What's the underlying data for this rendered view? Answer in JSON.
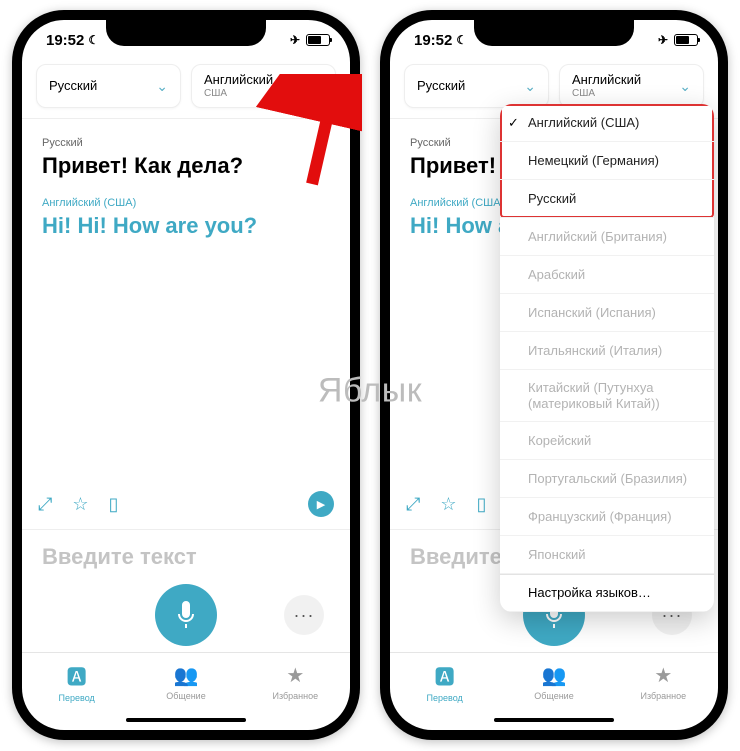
{
  "status": {
    "time": "19:52"
  },
  "lang_from": {
    "label": "Русский"
  },
  "lang_to": {
    "label": "Английский",
    "sub": "США"
  },
  "translation": {
    "src_lang": "Русский",
    "src_text": "Привет! Как дела?",
    "tgt_lang": "Английский (США)",
    "tgt_text": "Hi! Hi! How are you?",
    "tgt_text_clipped": "Hi! How a"
  },
  "input": {
    "placeholder": "Введите текст"
  },
  "tabs": {
    "translate": "Перевод",
    "conversation": "Общение",
    "favorites": "Избранное"
  },
  "dropdown": {
    "items": [
      {
        "label": "Английский (США)",
        "checked": true,
        "dim": false
      },
      {
        "label": "Немецкий (Германия)",
        "checked": false,
        "dim": false
      },
      {
        "label": "Русский",
        "checked": false,
        "dim": false
      },
      {
        "label": "Английский (Британия)",
        "checked": false,
        "dim": true
      },
      {
        "label": "Арабский",
        "checked": false,
        "dim": true
      },
      {
        "label": "Испанский (Испания)",
        "checked": false,
        "dim": true
      },
      {
        "label": "Итальянский (Италия)",
        "checked": false,
        "dim": true
      },
      {
        "label": "Китайский (Путунхуа (материковый Китай))",
        "checked": false,
        "dim": true
      },
      {
        "label": "Корейский",
        "checked": false,
        "dim": true
      },
      {
        "label": "Португальский (Бразилия)",
        "checked": false,
        "dim": true
      },
      {
        "label": "Французский (Франция)",
        "checked": false,
        "dim": true
      },
      {
        "label": "Японский",
        "checked": false,
        "dim": true
      }
    ],
    "settings": "Настройка языков…"
  },
  "watermark": "Яблык"
}
